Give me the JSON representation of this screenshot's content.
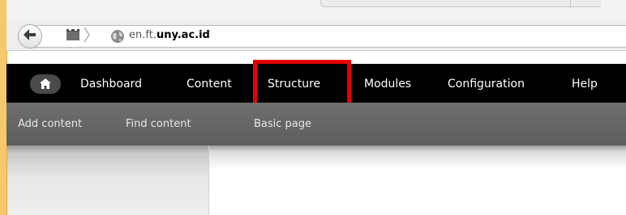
{
  "browser": {
    "url_prefix": "en.ft.",
    "url_domain": "uny.ac.id"
  },
  "toolbar": {
    "home_icon": "home-icon",
    "items": [
      "Dashboard",
      "Content",
      "Structure",
      "Modules",
      "Configuration",
      "Help"
    ],
    "highlighted": "Structure",
    "highlight_color": "#e30000"
  },
  "shortcuts": {
    "items": [
      "Add content",
      "Find content",
      "Basic page"
    ]
  }
}
